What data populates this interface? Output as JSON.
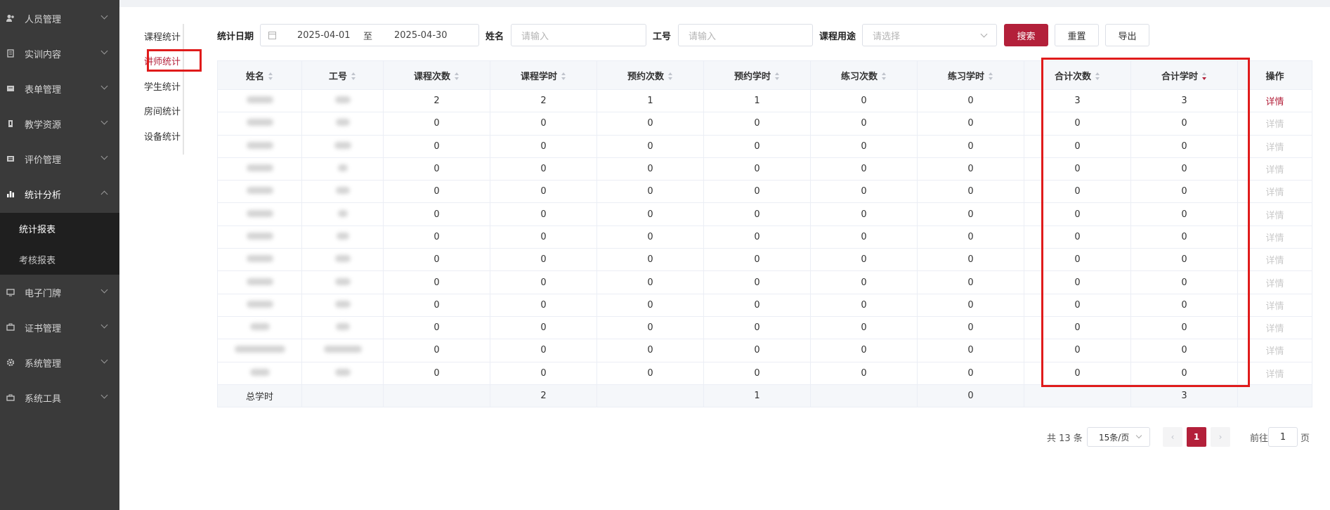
{
  "sidebar": {
    "items": [
      {
        "label": "人员管理",
        "icon": "users-icon"
      },
      {
        "label": "实训内容",
        "icon": "book-icon"
      },
      {
        "label": "表单管理",
        "icon": "form-icon"
      },
      {
        "label": "教学资源",
        "icon": "folder-icon"
      },
      {
        "label": "评价管理",
        "icon": "star-icon"
      },
      {
        "label": "统计分析",
        "icon": "bar-chart-icon"
      },
      {
        "label": "电子门牌",
        "icon": "monitor-icon"
      },
      {
        "label": "证书管理",
        "icon": "certificate-icon"
      },
      {
        "label": "系统管理",
        "icon": "gear-icon"
      },
      {
        "label": "系统工具",
        "icon": "toolbox-icon"
      }
    ],
    "submenu": [
      {
        "label": "统计报表",
        "active": true
      },
      {
        "label": "考核报表",
        "active": false
      }
    ]
  },
  "subnav": [
    "课程统计",
    "讲师统计",
    "学生统计",
    "房间统计",
    "设备统计"
  ],
  "filters": {
    "date_label": "统计日期",
    "date_start": "2025-04-01",
    "date_sep": "至",
    "date_end": "2025-04-30",
    "name_label": "姓名",
    "name_placeholder": "请输入",
    "id_label": "工号",
    "id_placeholder": "请输入",
    "purpose_label": "课程用途",
    "purpose_placeholder": "请选择"
  },
  "buttons": {
    "search": "搜索",
    "reset": "重置",
    "export": "导出"
  },
  "table": {
    "headers": [
      "姓名",
      "工号",
      "课程次数",
      "课程学时",
      "预约次数",
      "预约学时",
      "练习次数",
      "练习学时",
      "合计次数",
      "合计学时",
      "操作"
    ],
    "rows": [
      [
        2,
        2,
        1,
        1,
        0,
        0,
        3,
        3
      ],
      [
        0,
        0,
        0,
        0,
        0,
        0,
        0,
        0
      ],
      [
        0,
        0,
        0,
        0,
        0,
        0,
        0,
        0
      ],
      [
        0,
        0,
        0,
        0,
        0,
        0,
        0,
        0
      ],
      [
        0,
        0,
        0,
        0,
        0,
        0,
        0,
        0
      ],
      [
        0,
        0,
        0,
        0,
        0,
        0,
        0,
        0
      ],
      [
        0,
        0,
        0,
        0,
        0,
        0,
        0,
        0
      ],
      [
        0,
        0,
        0,
        0,
        0,
        0,
        0,
        0
      ],
      [
        0,
        0,
        0,
        0,
        0,
        0,
        0,
        0
      ],
      [
        0,
        0,
        0,
        0,
        0,
        0,
        0,
        0
      ],
      [
        0,
        0,
        0,
        0,
        0,
        0,
        0,
        0
      ],
      [
        0,
        0,
        0,
        0,
        0,
        0,
        0,
        0
      ],
      [
        0,
        0,
        0,
        0,
        0,
        0,
        0,
        0
      ]
    ],
    "detail_label": "详情",
    "summary": {
      "label": "总学时",
      "course_hours": "2",
      "booking_hours": "1",
      "practice_hours": "0",
      "total_hours": "3"
    }
  },
  "pagination": {
    "total": "共 13 条",
    "page_size": "15条/页",
    "current": "1",
    "goto_label": "前往",
    "goto_value": "1",
    "page_suffix": "页",
    "prev": "‹",
    "next": "›"
  },
  "colors": {
    "accent": "#b3203a",
    "highlight": "#e01b1b",
    "sidebar": "#3a3a3a"
  }
}
